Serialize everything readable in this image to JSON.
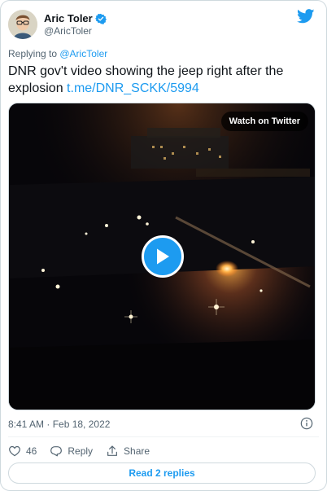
{
  "author": {
    "name": "Aric Toler",
    "handle": "@AricToler"
  },
  "reply": {
    "prefix": "Replying to ",
    "target": "@AricToler"
  },
  "tweet": {
    "text": "DNR gov't video showing the jeep right after the explosion ",
    "link": "t.me/DNR_SCKK/5994"
  },
  "media": {
    "watch_label": "Watch on Twitter"
  },
  "timestamp": "8:41 AM · Feb 18, 2022",
  "actions": {
    "likes": "46",
    "reply_label": "Reply",
    "share_label": "Share"
  },
  "read_replies_label": "Read 2 replies",
  "colors": {
    "accent": "#1d9bf0",
    "secondary_text": "#536471",
    "border": "#cfd9de"
  },
  "icons": [
    "twitter-bird-icon",
    "verified-badge-icon",
    "play-icon",
    "info-icon",
    "heart-icon",
    "reply-icon",
    "share-icon"
  ]
}
